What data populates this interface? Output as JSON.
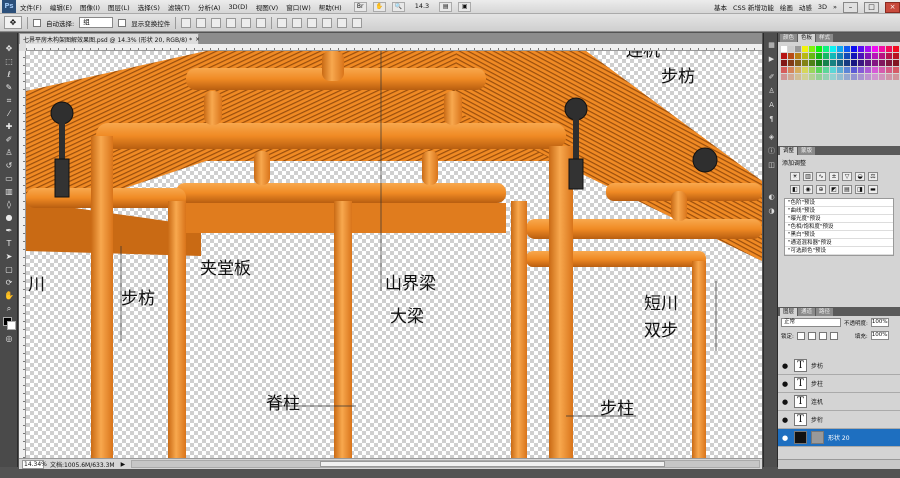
{
  "app": {
    "logo": "Ps"
  },
  "menu": {
    "items": [
      "文件(F)",
      "编辑(E)",
      "图像(I)",
      "图层(L)",
      "选择(S)",
      "滤镜(T)",
      "分析(A)",
      "3D(D)",
      "视图(V)",
      "窗口(W)",
      "帮助(H)"
    ],
    "zoom_value": "14.3",
    "workspaces": [
      "基本",
      "CSS 新增功能",
      "绘画",
      "动感",
      "3D"
    ],
    "ws_more": "»"
  },
  "options": {
    "auto_select_label": "自动选择:",
    "auto_select_value": "组",
    "transform_label": "显示变换控件"
  },
  "document": {
    "tab_title": "七界平房木构架图解效果图.psd @ 14.3% (形状 20, RGB/8) *",
    "zoom": "14.34%",
    "doc_info": "文档:1005.6M/633.3M",
    "labels": {
      "bufang_top": "步枋",
      "lianji": "连机",
      "jiatangban": "夹堂板",
      "bufang_left": "步枋",
      "shanjieliang": "山界梁",
      "daliang": "大梁",
      "duanchuan": "短川",
      "shuangbu": "双步",
      "jizhu": "脊柱",
      "buzhu": "步柱",
      "left_edge": "川"
    }
  },
  "panels": {
    "swatch_tabs": [
      "颜色",
      "色板",
      "样式"
    ],
    "adjust_tabs": [
      "调整",
      "蒙版"
    ],
    "adjust_title": "添加调整",
    "presets": [
      "\"色阶\"预设",
      "\"曲线\"预设",
      "\"曝光度\"预设",
      "\"色相/饱和度\"预设",
      "\"黑白\"预设",
      "\"通道混和器\"预设",
      "\"可选颜色\"预设"
    ],
    "layer_tabs": [
      "图层",
      "通道",
      "路径"
    ],
    "blend_mode": "正常",
    "opacity_label": "不透明度:",
    "opacity": "100%",
    "lock_label": "锁定:",
    "fill_label": "填充:",
    "fill": "100%",
    "layers": [
      {
        "name": "步枋",
        "type": "text",
        "selected": false
      },
      {
        "name": "步柱",
        "type": "text",
        "selected": false
      },
      {
        "name": "连机",
        "type": "text",
        "selected": false
      },
      {
        "name": "步桁",
        "type": "text",
        "selected": false
      },
      {
        "name": "形状 20",
        "type": "shape",
        "selected": true
      }
    ]
  },
  "colors": {
    "timber": "#f08a24",
    "timber_dark": "#b85e10",
    "timber_light": "#f8a84e",
    "selection": "#1e6fc0"
  }
}
